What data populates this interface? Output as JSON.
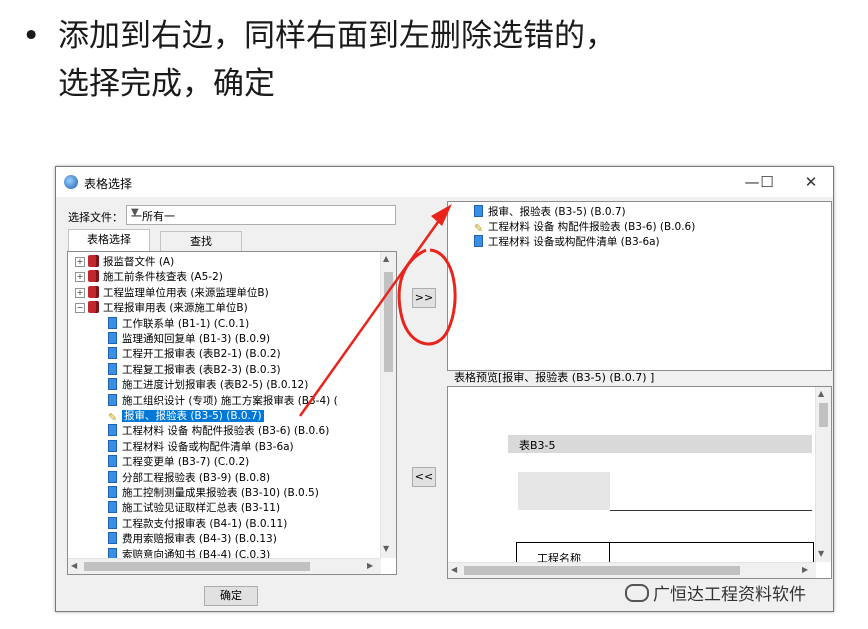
{
  "slide": {
    "bullet": "•",
    "line1": "添加到右边，同样右面到左删除选错的，",
    "line2": "选择完成，确定"
  },
  "window": {
    "title": "表格选择",
    "minimize": "—",
    "maximize": "☐",
    "close": "✕"
  },
  "file_select": {
    "label": "选择文件：",
    "value": "一所有一"
  },
  "tabs": [
    "表格选择",
    "查找"
  ],
  "tree": [
    {
      "level": 0,
      "icon": "book",
      "expander": "+",
      "text": "报监督文件 (A)"
    },
    {
      "level": 0,
      "icon": "book",
      "expander": "+",
      "text": "施工前条件核查表 (A5-2)"
    },
    {
      "level": 0,
      "icon": "book",
      "expander": "+",
      "text": "工程监理单位用表 (来源监理单位B)"
    },
    {
      "level": 0,
      "icon": "book",
      "expander": "−",
      "text": "工程报审用表 (来源施工单位B)"
    },
    {
      "level": 1,
      "icon": "doc",
      "text": "工作联系单 (B1-1) (C.0.1)"
    },
    {
      "level": 1,
      "icon": "doc",
      "text": "监理通知回复单 (B1-3) (B.0.9)"
    },
    {
      "level": 1,
      "icon": "doc",
      "text": "工程开工报审表 (表B2-1) (B.0.2)"
    },
    {
      "level": 1,
      "icon": "doc",
      "text": "工程复工报审表 (表B2-3) (B.0.3)"
    },
    {
      "level": 1,
      "icon": "doc",
      "text": "施工进度计划报审表 (表B2-5) (B.0.12)"
    },
    {
      "level": 1,
      "icon": "doc",
      "text": "施工组织设计 (专项) 施工方案报审表 (B3-4) ("
    },
    {
      "level": 1,
      "icon": "pen",
      "text": "报审、报验表 (B3-5) (B.0.7)",
      "selected": true
    },
    {
      "level": 1,
      "icon": "doc",
      "text": "工程材料 设备 构配件报验表 (B3-6) (B.0.6)"
    },
    {
      "level": 1,
      "icon": "doc",
      "text": "工程材料 设备或构配件清单 (B3-6a)"
    },
    {
      "level": 1,
      "icon": "doc",
      "text": "工程变更单 (B3-7) (C.0.2)"
    },
    {
      "level": 1,
      "icon": "doc",
      "text": "分部工程报验表 (B3-9) (B.0.8)"
    },
    {
      "level": 1,
      "icon": "doc",
      "text": "施工控制测量成果报验表 (B3-10) (B.0.5)"
    },
    {
      "level": 1,
      "icon": "doc",
      "text": "施工试验见证取样汇总表 (B3-11)"
    },
    {
      "level": 1,
      "icon": "doc",
      "text": "工程款支付报审表 (B4-1) (B.0.11)"
    },
    {
      "level": 1,
      "icon": "doc",
      "text": "费用索赔报审表 (B4-3) (B.0.13)"
    },
    {
      "level": 1,
      "icon": "doc",
      "text": "索赔意向通知书 (B4-4) (C.0.3)"
    }
  ],
  "buttons": {
    "add": ">>",
    "remove": "<<",
    "ok": "确定"
  },
  "selected_list": [
    {
      "icon": "doc",
      "text": "报审、报验表 (B3-5) (B.0.7)"
    },
    {
      "icon": "pen",
      "text": "工程材料 设备 构配件报验表 (B3-6) (B.0.6)"
    },
    {
      "icon": "doc",
      "text": "工程材料 设备或构配件清单 (B3-6a)"
    }
  ],
  "preview": {
    "label": "表格预览[报审、报验表 (B3-5) (B.0.7) ]",
    "form_code": "表B3-5",
    "project_name_label": "工程名称"
  },
  "watermark": "广恒达工程资料软件"
}
